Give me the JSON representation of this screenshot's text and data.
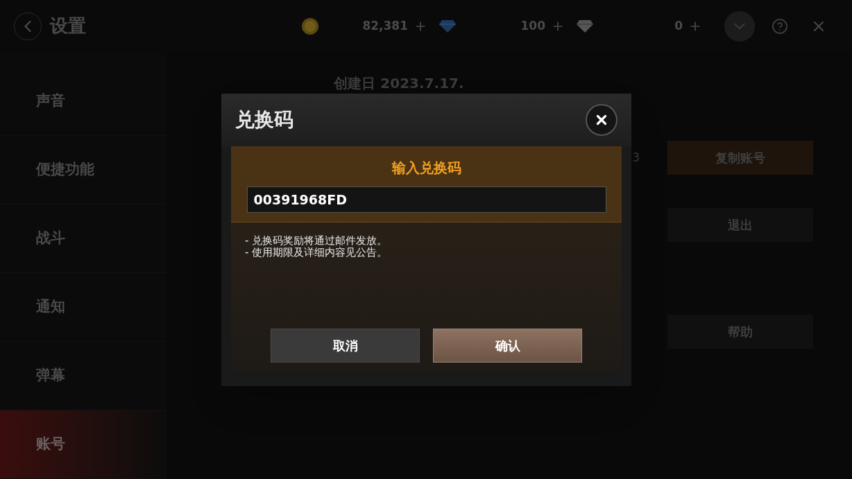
{
  "header": {
    "title": "设置"
  },
  "currencies": [
    {
      "kind": "coin",
      "amount": "82,381"
    },
    {
      "kind": "diamond",
      "amount": "100"
    },
    {
      "kind": "gem",
      "amount": "0"
    }
  ],
  "sidebar": {
    "items": [
      {
        "label": "声音",
        "selected": false
      },
      {
        "label": "便捷功能",
        "selected": false
      },
      {
        "label": "战斗",
        "selected": false
      },
      {
        "label": "通知",
        "selected": false
      },
      {
        "label": "弹幕",
        "selected": false
      },
      {
        "label": "账号",
        "selected": true
      }
    ]
  },
  "account": {
    "created": "创建日 2023.7.17.",
    "id_fragment": "3",
    "buttons": [
      {
        "label": "复制账号",
        "kind": "accent"
      },
      {
        "label": "退出",
        "kind": "plain"
      },
      {
        "label": "帮助",
        "kind": "plain"
      }
    ]
  },
  "dialog": {
    "title": "兑换码",
    "prompt": "输入兑换码",
    "code": {
      "value": "00391968FD"
    },
    "notes": [
      "- 兑换码奖励将通过邮件发放。",
      "- 使用期限及详细内容见公告。"
    ],
    "buttons": [
      {
        "label": "取消",
        "kind": "secondary"
      },
      {
        "label": "确认",
        "kind": "primary"
      }
    ]
  }
}
